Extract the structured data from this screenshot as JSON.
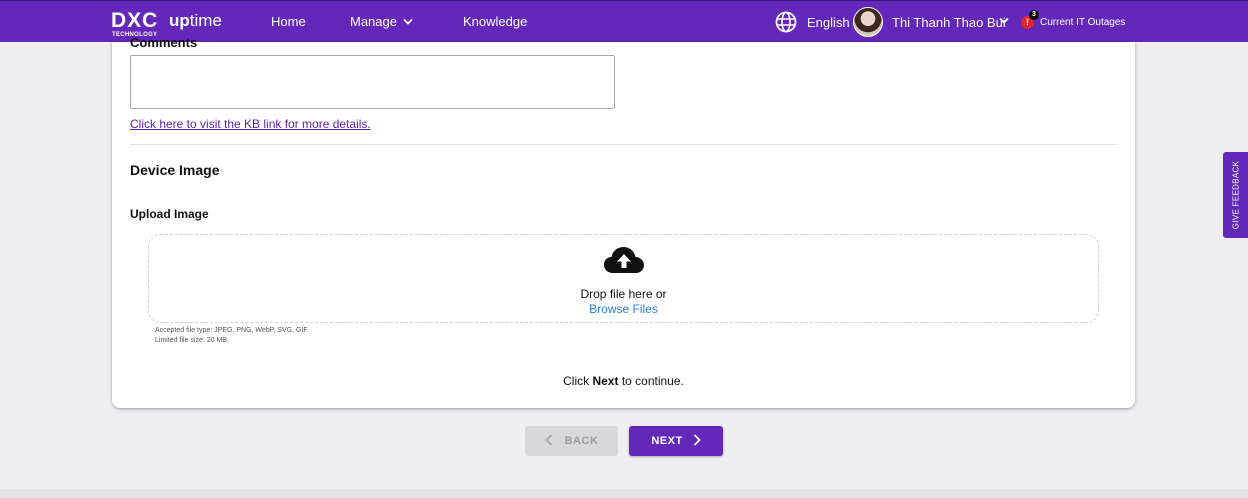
{
  "header": {
    "logo": {
      "brand": "DXC",
      "tagline": "TECHNOLOGY",
      "product_bold": "up",
      "product_rest": "time"
    },
    "nav": {
      "home": "Home",
      "manage": "Manage",
      "knowledge": "Knowledge"
    },
    "language": "English",
    "user_name": "Thi Thanh Thao Bui",
    "outages": {
      "count": "3",
      "label": "Current IT Outages",
      "icon_mark": "!"
    },
    "brand_color": "#6328ba"
  },
  "form": {
    "comments_label": "Comments",
    "comments_value": "",
    "kb_link": "Click here to visit the KB link for more details.",
    "section_title": "Device Image",
    "upload_label": "Upload Image",
    "dropzone": {
      "icon": "cloud-upload-icon",
      "text": "Drop file here or",
      "browse": "Browse Files"
    },
    "accepted_types": "Accepted file type: JPEG, PNG, WebP, SVG, GIF.",
    "size_limit": "Limited file size: 20 MB.",
    "continue": {
      "before": "Click ",
      "bold": "Next",
      "after": " to continue."
    }
  },
  "actions": {
    "back": "BACK",
    "next": "NEXT"
  },
  "feedback_tab": "GIVE FEEDBACK"
}
